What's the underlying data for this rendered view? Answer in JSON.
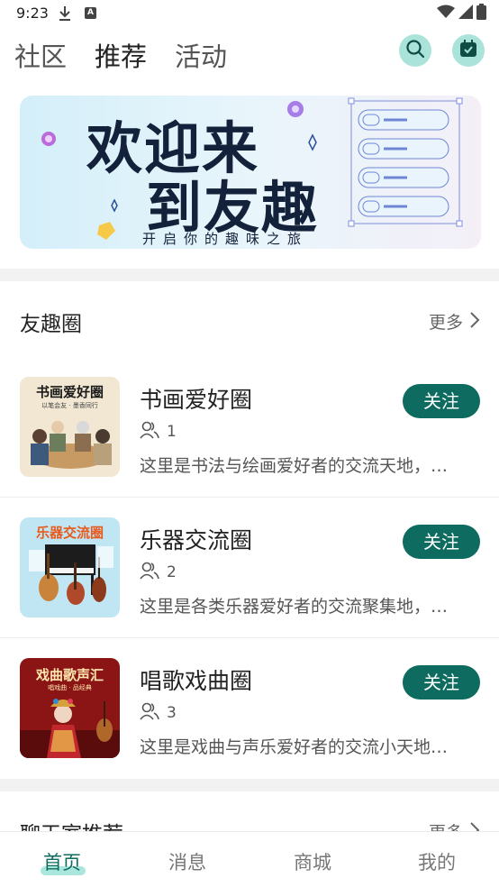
{
  "status": {
    "time": "9:23",
    "icons": [
      "download-icon",
      "a-icon",
      "wifi-icon",
      "signal-icon",
      "battery-icon"
    ]
  },
  "top_tabs": [
    {
      "label": "社区",
      "active": false
    },
    {
      "label": "推荐",
      "active": true
    },
    {
      "label": "活动",
      "active": false
    }
  ],
  "top_icons": [
    "search-icon",
    "calendar-icon"
  ],
  "banner": {
    "line1": "欢迎来",
    "line2": "到友趣",
    "subtitle": "开启你的趣味之旅"
  },
  "circles_section": {
    "title": "友趣圈",
    "more": "更多",
    "items": [
      {
        "name": "书画爱好圈",
        "members": "1",
        "description": "这里是书法与绘画爱好者的交流天地，…",
        "follow": "关注",
        "thumb_title": "书画爱好圈",
        "thumb_caption": "以笔会友 · 墨香同行"
      },
      {
        "name": "乐器交流圈",
        "members": "2",
        "description": "这里是各类乐器爱好者的交流聚集地，…",
        "follow": "关注",
        "thumb_title": "乐器交流圈"
      },
      {
        "name": "唱歌戏曲圈",
        "members": "3",
        "description": "这里是戏曲与声乐爱好者的交流小天地…",
        "follow": "关注",
        "thumb_title": "戏曲歌声汇",
        "thumb_caption": "唱戏曲 · 品经典"
      }
    ]
  },
  "chat_section": {
    "title": "聊天室推荐",
    "more": "更多"
  },
  "bottom_nav": [
    {
      "label": "首页",
      "active": true
    },
    {
      "label": "消息",
      "active": false
    },
    {
      "label": "商城",
      "active": false
    },
    {
      "label": "我的",
      "active": false
    }
  ],
  "colors": {
    "accent": "#0e6b5f",
    "accent_light": "#a9e7dc",
    "divider": "#f2f2f2"
  }
}
